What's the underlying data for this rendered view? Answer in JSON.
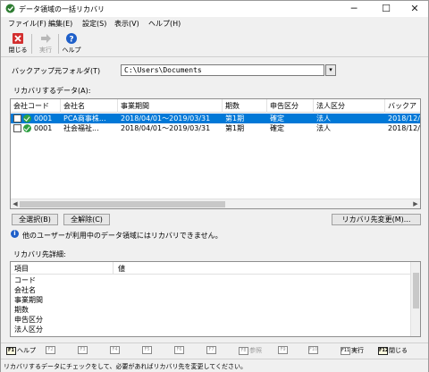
{
  "window": {
    "title": "データ領域の一括リカバリ",
    "minimize": "─",
    "maximize": "☐",
    "close": "✕"
  },
  "menu": [
    "ファイル(F)",
    "編集(E)",
    "設定(S)",
    "表示(V)",
    "ヘルプ(H)"
  ],
  "toolbar": {
    "close_label": "閉じる",
    "run_label": "実行",
    "help_label": "ヘルプ"
  },
  "folder": {
    "label": "バックアップ元フォルダ(T)",
    "value": "C:\\Users\\Documents"
  },
  "recover_label": "リカバリするデータ(A):",
  "table": {
    "columns": [
      "会社コード",
      "会社名",
      "事業期間",
      "期数",
      "申告区分",
      "法人区分",
      "バックア"
    ],
    "rows": [
      {
        "code": "0001",
        "name": "PCA商事株...",
        "period": "2018/04/01～2019/03/31",
        "term": "第1期",
        "filing": "確定",
        "corp": "法人",
        "backup": "2018/12/",
        "selected": true
      },
      {
        "code": "0001",
        "name": "社会福祉...",
        "period": "2018/04/01～2019/03/31",
        "term": "第1期",
        "filing": "確定",
        "corp": "法人",
        "backup": "2018/12/",
        "selected": false
      }
    ]
  },
  "buttons": {
    "select_all": "全選択(B)",
    "deselect_all": "全解除(C)",
    "change_dest": "リカバリ先変更(M)..."
  },
  "info_text": "他のユーザーが利用中のデータ領域にはリカバリできません。",
  "detail": {
    "label": "リカバリ先詳細:",
    "col_item": "項目",
    "col_value": "値",
    "items": [
      "コード",
      "会社名",
      "事業期間",
      "期数",
      "申告区分",
      "法人区分"
    ]
  },
  "fkeys": [
    {
      "key": "F1",
      "label": "ヘルプ"
    },
    {
      "key": "F2",
      "label": ""
    },
    {
      "key": "F3",
      "label": ""
    },
    {
      "key": "F4",
      "label": ""
    },
    {
      "key": "F5",
      "label": ""
    },
    {
      "key": "F6",
      "label": ""
    },
    {
      "key": "F7",
      "label": ""
    },
    {
      "key": "F8",
      "label": "参照"
    },
    {
      "key": "F9",
      "label": ""
    },
    {
      "key": "F10",
      "label": ""
    },
    {
      "key": "F11",
      "label": "実行"
    },
    {
      "key": "F12",
      "label": "閉じる"
    }
  ],
  "status": "リカバリするデータにチェックをして、必要があればリカバリ先を変更してください。",
  "colors": {
    "selection": "#0078d7",
    "ok": "#2ea043",
    "info": "#1e5fc9",
    "close_icon": "#d32f2f"
  }
}
